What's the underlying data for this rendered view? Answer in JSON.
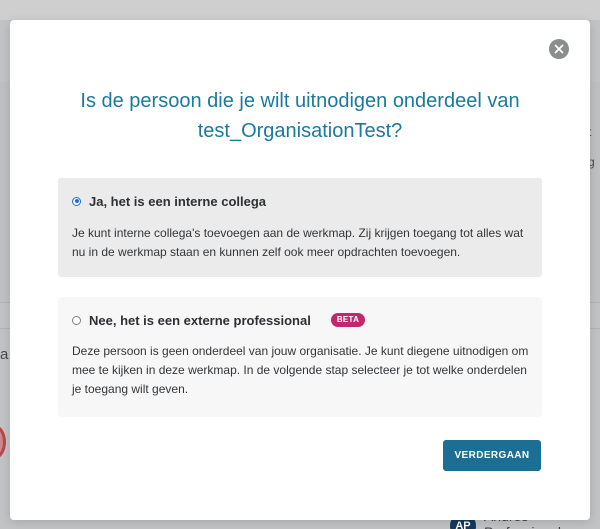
{
  "background": {
    "fragment_left": "a",
    "fragment_right_1": "t",
    "fragment_right_2": "g",
    "user_initials": "AP",
    "user_name": "Andres Professional"
  },
  "modal": {
    "title_line1": "Is de persoon die je wilt uitnodigen onderdeel van",
    "title_line2": "test_OrganisationTest?",
    "close_icon": "close-icon",
    "options": [
      {
        "label": "Ja, het is een interne collega",
        "description": "Je kunt interne collega's toevoegen aan de werkmap. Zij krijgen toegang tot alles wat nu in de werkmap staan en kunnen zelf ook meer opdrachten toevoegen.",
        "selected": true
      },
      {
        "label": "Nee, het is een externe professional",
        "badge": "BETA",
        "description": "Deze persoon is geen onderdeel van jouw organisatie. Je kunt diegene uitnodigen om mee te kijken in deze werkmap. In de volgende stap selecteer je tot welke onderdelen je toegang wilt geven.",
        "selected": false
      }
    ],
    "continue_label": "VERDERGAAN"
  },
  "colors": {
    "title": "#1a7a9e",
    "primary_button": "#1c6f94",
    "badge": "#c4276f",
    "radio_checked": "#1a6fd6"
  }
}
